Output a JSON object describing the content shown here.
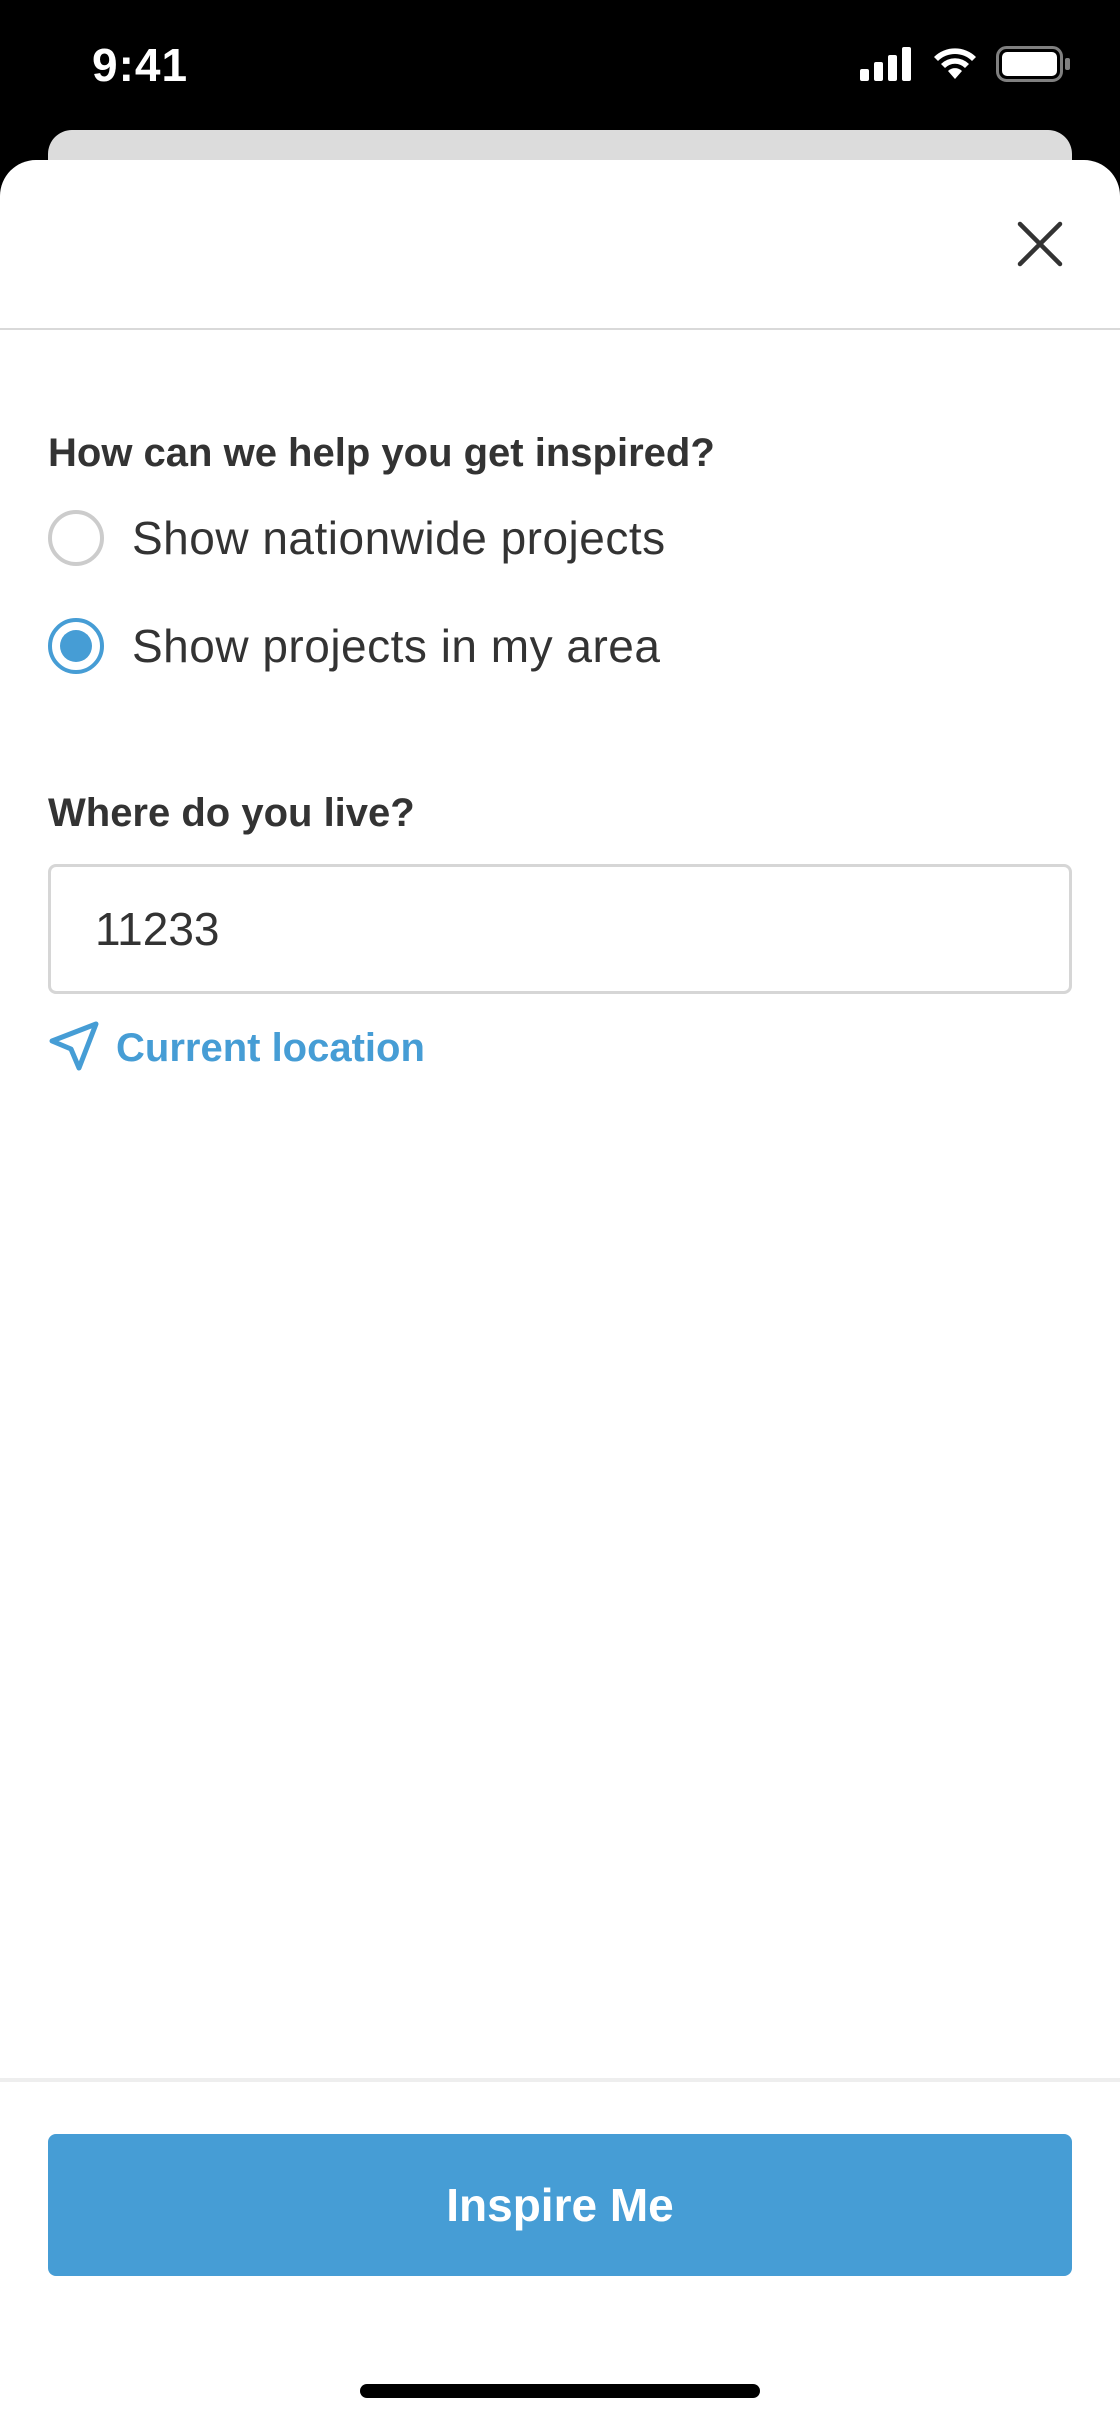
{
  "status_bar": {
    "time": "9:41",
    "icons": [
      "cellular-signal-icon",
      "wifi-icon",
      "battery-icon"
    ]
  },
  "sheet": {
    "close_icon": "close-icon",
    "inspiration": {
      "title": "How can we help you get inspired?",
      "options": [
        {
          "label": "Show nationwide projects",
          "selected": false
        },
        {
          "label": "Show projects in my area",
          "selected": true
        }
      ]
    },
    "location": {
      "title": "Where do you live?",
      "zip_value": "11233",
      "current_location_label": "Current location",
      "current_location_icon": "location-arrow-icon"
    },
    "footer": {
      "button_label": "Inspire Me"
    }
  },
  "colors": {
    "accent": "#469dd5",
    "text": "#333333",
    "radio_border": "#cccccc",
    "input_border": "#d6d6d6"
  }
}
